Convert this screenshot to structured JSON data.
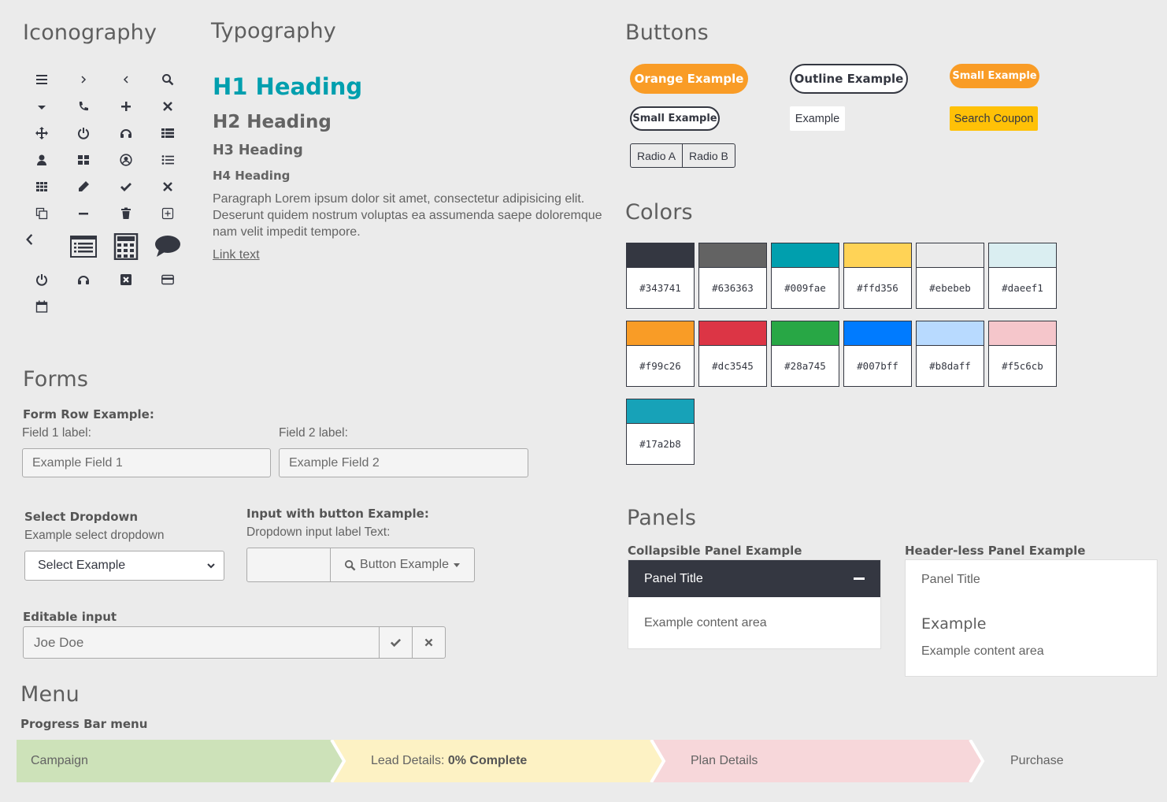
{
  "iconography": {
    "title": "Iconography",
    "icons": [
      "menu-icon",
      "chevron-right-icon",
      "chevron-left-icon",
      "search-icon",
      "caret-down-icon",
      "phone-icon",
      "plus-icon",
      "close-icon",
      "move-icon",
      "power-icon",
      "headset-icon",
      "list-icon",
      "user-icon",
      "grid-icon",
      "user-circle-icon",
      "list-ul-icon",
      "apps-icon",
      "pencil-icon",
      "check-icon",
      "times-icon",
      "copy-icon",
      "minus-icon",
      "trash-icon",
      "plus-square-icon",
      "angle-left-icon",
      "list-alt-icon",
      "calculator-icon",
      "comment-icon",
      "power-off-icon",
      "headphones-icon",
      "close-square-icon",
      "credit-card-icon",
      "calendar-icon"
    ]
  },
  "typography": {
    "title": "Typography",
    "h1": "H1 Heading",
    "h2": "H2 Heading",
    "h3": "H3 Heading",
    "h4": "H4 Heading",
    "paragraph": "Paragraph Lorem ipsum dolor sit amet, consectetur adipisicing elit. Deserunt quidem nostrum voluptas ea assumenda saepe doloremque nam velit impedit tempore.",
    "link": "Link text"
  },
  "buttons": {
    "title": "Buttons",
    "orange": "Orange Example",
    "outline": "Outline Example",
    "small_orange": "Small Example",
    "small_outline": "Small Example",
    "plain": "Example",
    "search_coupon": "Search Coupon",
    "radio_a": "Radio A",
    "radio_b": "Radio B"
  },
  "colors": {
    "title": "Colors",
    "swatches": [
      "#343741",
      "#636363",
      "#009fae",
      "#ffd356",
      "#ebebeb",
      "#daeef1",
      "#f99c26",
      "#dc3545",
      "#28a745",
      "#007bff",
      "#b8daff",
      "#f5c6cb",
      "#17a2b8"
    ]
  },
  "forms": {
    "title": "Forms",
    "form_row_label": "Form Row Example:",
    "field1_label": "Field 1 label:",
    "field1_placeholder": "Example Field 1",
    "field2_label": "Field 2 label:",
    "field2_placeholder": "Example Field 2",
    "select_title": "Select Dropdown",
    "select_label": "Example select dropdown",
    "select_value": "Select Example",
    "input_btn_title": "Input with button Example:",
    "input_btn_label": "Dropdown input label Text:",
    "input_btn_button": "Button Example",
    "editable_title": "Editable input",
    "editable_value": "Joe Doe"
  },
  "panels": {
    "title": "Panels",
    "collapsible_label": "Collapsible Panel Example",
    "collapsible_title": "Panel Title",
    "collapsible_content": "Example content area",
    "headerless_label": "Header-less Panel Example",
    "headerless_title": "Panel Title",
    "headerless_heading": "Example",
    "headerless_content": "Example content area"
  },
  "menu": {
    "title": "Menu",
    "progress_label": "Progress Bar menu",
    "steps": [
      {
        "label": "Campaign",
        "color": "#cde2b9"
      },
      {
        "label": "Lead Details:",
        "bold": "0% Complete",
        "color": "#fdf2c4"
      },
      {
        "label": "Plan Details",
        "color": "#f7d7da"
      },
      {
        "label": "Purchase",
        "color": "#ebebeb"
      }
    ]
  }
}
